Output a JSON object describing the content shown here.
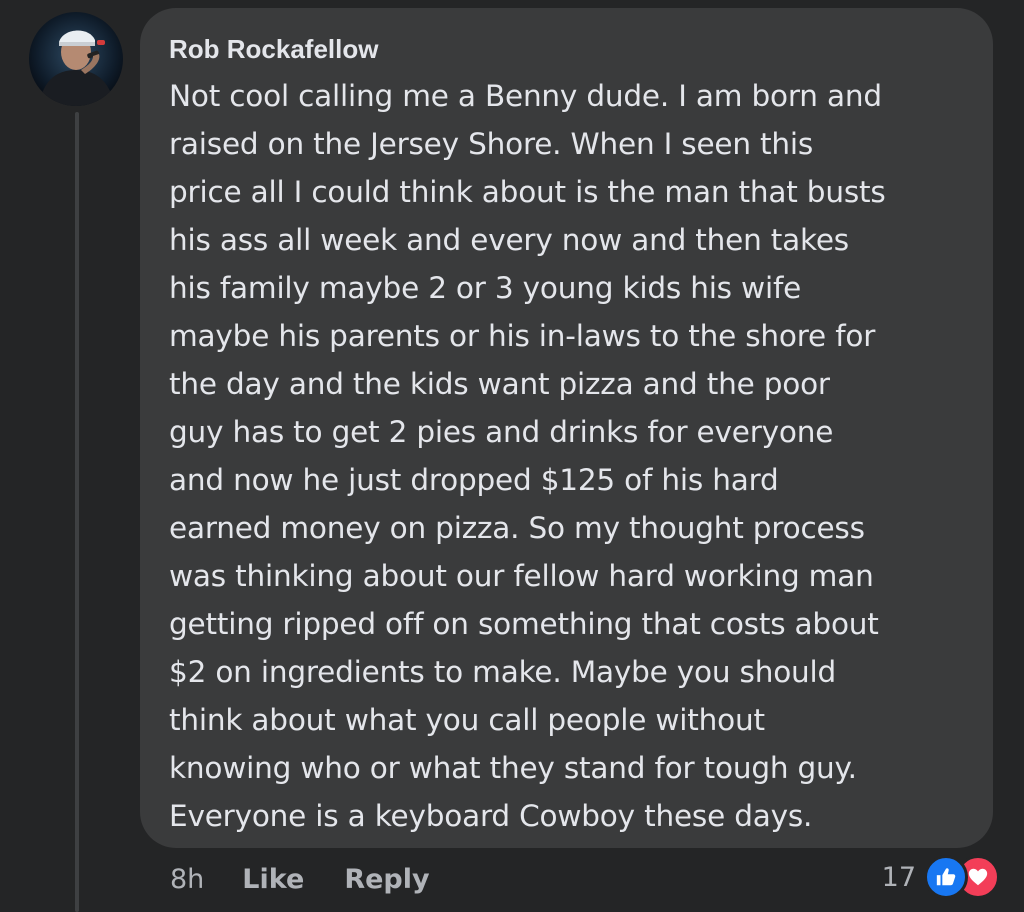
{
  "comment": {
    "author": "Rob Rockafellow",
    "text": "Not cool calling me a Benny dude. I am born and\nraised on the Jersey Shore. When I seen this\nprice all I could think about is the man that busts\nhis ass all week and every now and then takes\nhis family maybe 2 or 3 young kids his wife\nmaybe his parents or his in-laws to the shore for\nthe day and the kids want pizza and the poor\nguy has to get 2 pies and drinks for everyone\nand now he just dropped $125 of his hard\nearned money on pizza. So my thought process\nwas thinking about our fellow hard working man\ngetting ripped off on something that costs about\n$2 on ingredients to make. Maybe you should\nthink about what you call people without\nknowing who or what they stand for tough guy.\nEveryone is a keyboard Cowboy these days.",
    "time": "8h",
    "like_label": "Like",
    "reply_label": "Reply",
    "reaction_count": "17",
    "reactions": [
      "like-icon",
      "love-icon"
    ]
  },
  "colors": {
    "background": "#242526",
    "bubble": "#3a3b3c",
    "text": "#e4e6eb",
    "secondary_text": "#b0b3b8",
    "like_blue": "#1877f2",
    "love_red": "#f33e58"
  }
}
